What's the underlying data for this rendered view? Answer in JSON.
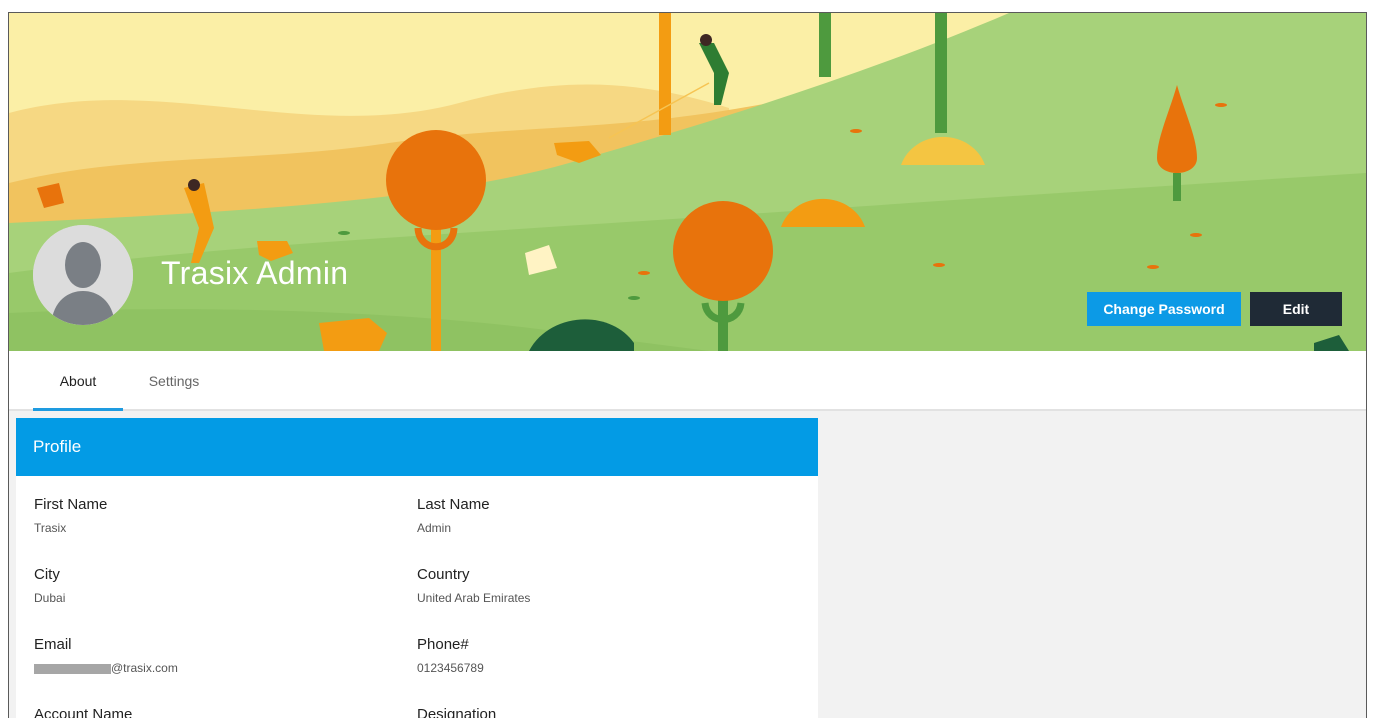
{
  "user": {
    "name": "Trasix Admin"
  },
  "actions": {
    "change_password": "Change Password",
    "edit": "Edit"
  },
  "tabs": [
    {
      "label": "About",
      "active": true
    },
    {
      "label": "Settings",
      "active": false
    }
  ],
  "profile": {
    "title": "Profile",
    "fields": [
      {
        "label": "First Name",
        "value": "Trasix"
      },
      {
        "label": "Last Name",
        "value": "Admin"
      },
      {
        "label": "City",
        "value": "Dubai"
      },
      {
        "label": "Country",
        "value": "United Arab Emirates"
      },
      {
        "label": "Email",
        "value": "@trasix.com"
      },
      {
        "label": "Phone#",
        "value": "0123456789"
      },
      {
        "label": "Account Name",
        "value": ""
      },
      {
        "label": "Designation",
        "value": ""
      }
    ]
  },
  "colors": {
    "primary": "#039be5",
    "button_dark": "#1f2a36",
    "tab_underline": "#1e9be0"
  }
}
